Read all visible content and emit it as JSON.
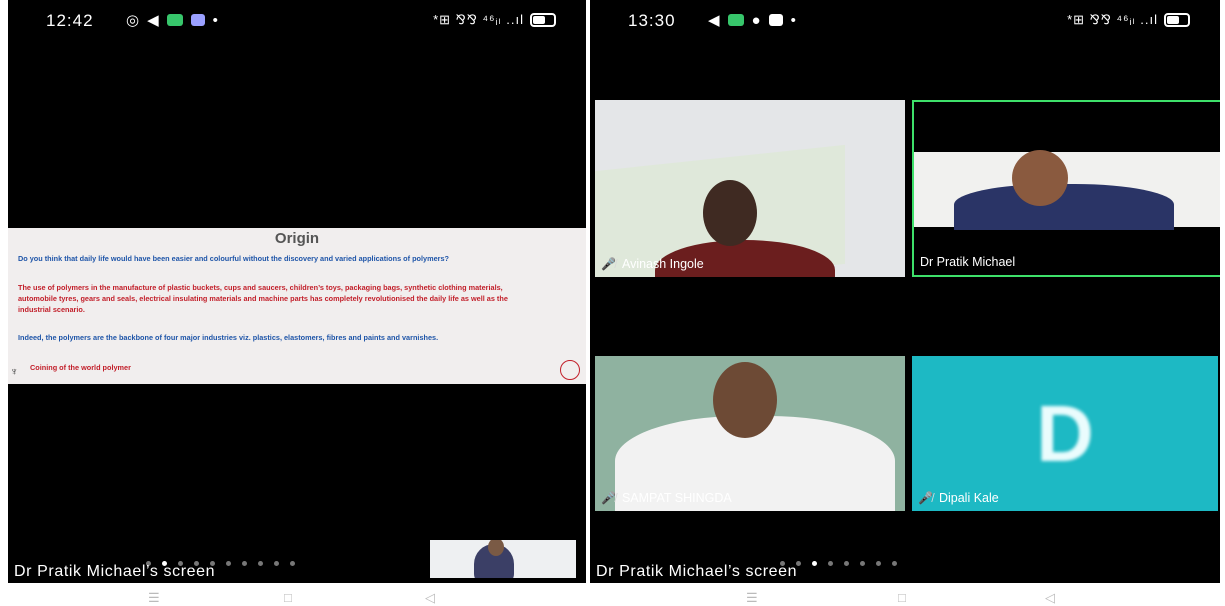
{
  "left_phone": {
    "status": {
      "time": "12:42",
      "right_text": "*⊞ ⅋⅋ ⁴⁶ᵢₗ ..ıl"
    },
    "slide": {
      "title": "Origin",
      "bullets": [
        "Do you think that daily life would have been easier and colourful without the discovery and varied applications of polymers?",
        "The use of polymers in the manufacture of plastic buckets, cups and saucers, children’s toys, packaging bags, synthetic clothing materials, automobile tyres, gears and seals, electrical insulating materials and machine parts has completely revolutionised the daily life as well as the industrial scenario.",
        "Indeed, the polymers are the backbone of four major industries viz.  plastics, elastomers, fibres and paints and varnishes.",
        "Coining of the world polymer"
      ]
    },
    "screen_label": "Dr Pratik Michael’s screen"
  },
  "right_phone": {
    "status": {
      "time": "13:30",
      "right_text": "*⊞ ⅋⅋ ⁴⁶ᵢₗ ..ıl"
    },
    "participants": [
      {
        "name": "Avinash Ingole"
      },
      {
        "name": "Dr Pratik Michael"
      },
      {
        "name": "SAMPAT SHINGDA"
      },
      {
        "name": "Dipali Kale",
        "initial": "D"
      }
    ],
    "screen_label": "Dr Pratik Michael’s screen"
  },
  "nav_icons": [
    "menu-icon",
    "home-icon",
    "back-icon"
  ],
  "colors": {
    "active_speaker_border": "#3ee06a",
    "slide_blue": "#1f55a8",
    "slide_red": "#c21f2a",
    "avatar_bg": "#1db9c4"
  }
}
